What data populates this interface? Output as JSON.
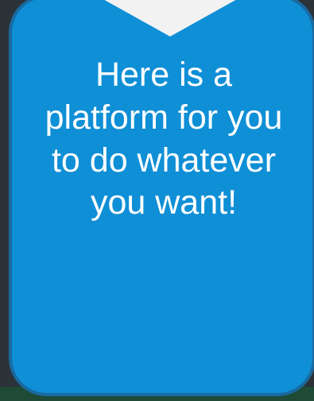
{
  "callout": {
    "text": "Here is a platform for you to do whatever you want!",
    "fill_color": "#0f8fd6",
    "border_color": "#1a6aa0",
    "text_color": "#ffffff",
    "arrow_color": "#ffffff",
    "background_color": "#2b3238",
    "bottom_strip_color": "#1f4a36"
  }
}
